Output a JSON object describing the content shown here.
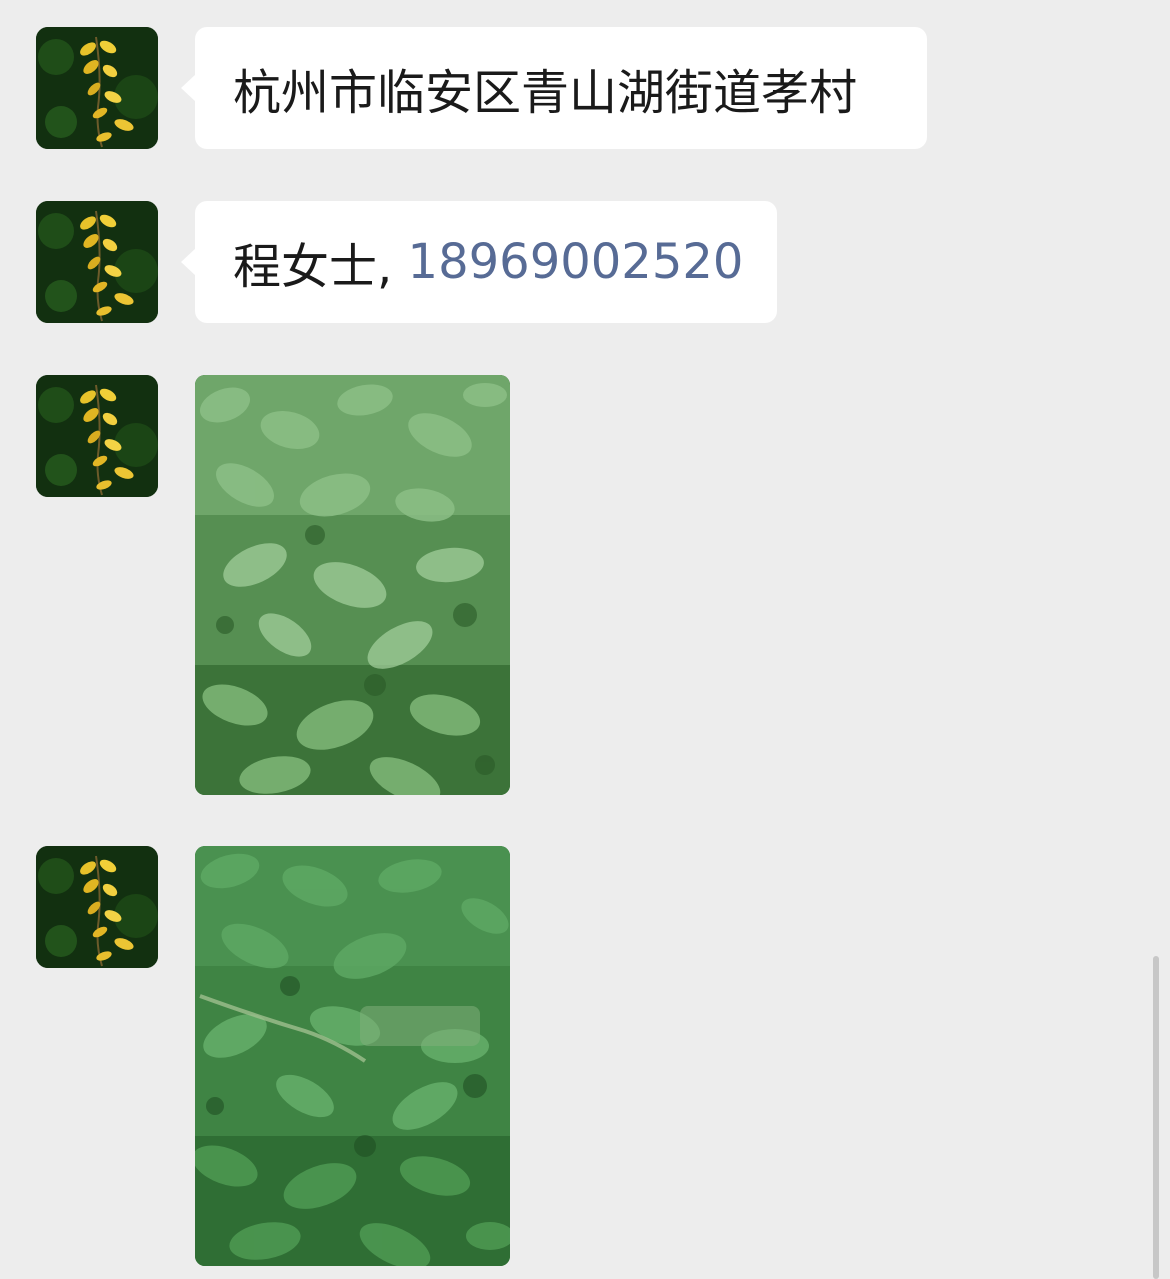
{
  "chat": {
    "messages": [
      {
        "type": "text",
        "avatar": "vine-leaves-avatar",
        "text": "杭州市临安区青山湖街道孝村"
      },
      {
        "type": "text",
        "avatar": "vine-leaves-avatar",
        "name_text": "程女士, ",
        "phone": "18969002520"
      },
      {
        "type": "image",
        "avatar": "vine-leaves-avatar",
        "image": "green-leafy-plants-photo"
      },
      {
        "type": "image",
        "avatar": "vine-leaves-avatar",
        "image": "watermelon-vine-plants-photo"
      }
    ]
  },
  "colors": {
    "background": "#ededed",
    "bubble": "#ffffff",
    "link": "#576b95",
    "text": "#1a1a1a"
  }
}
